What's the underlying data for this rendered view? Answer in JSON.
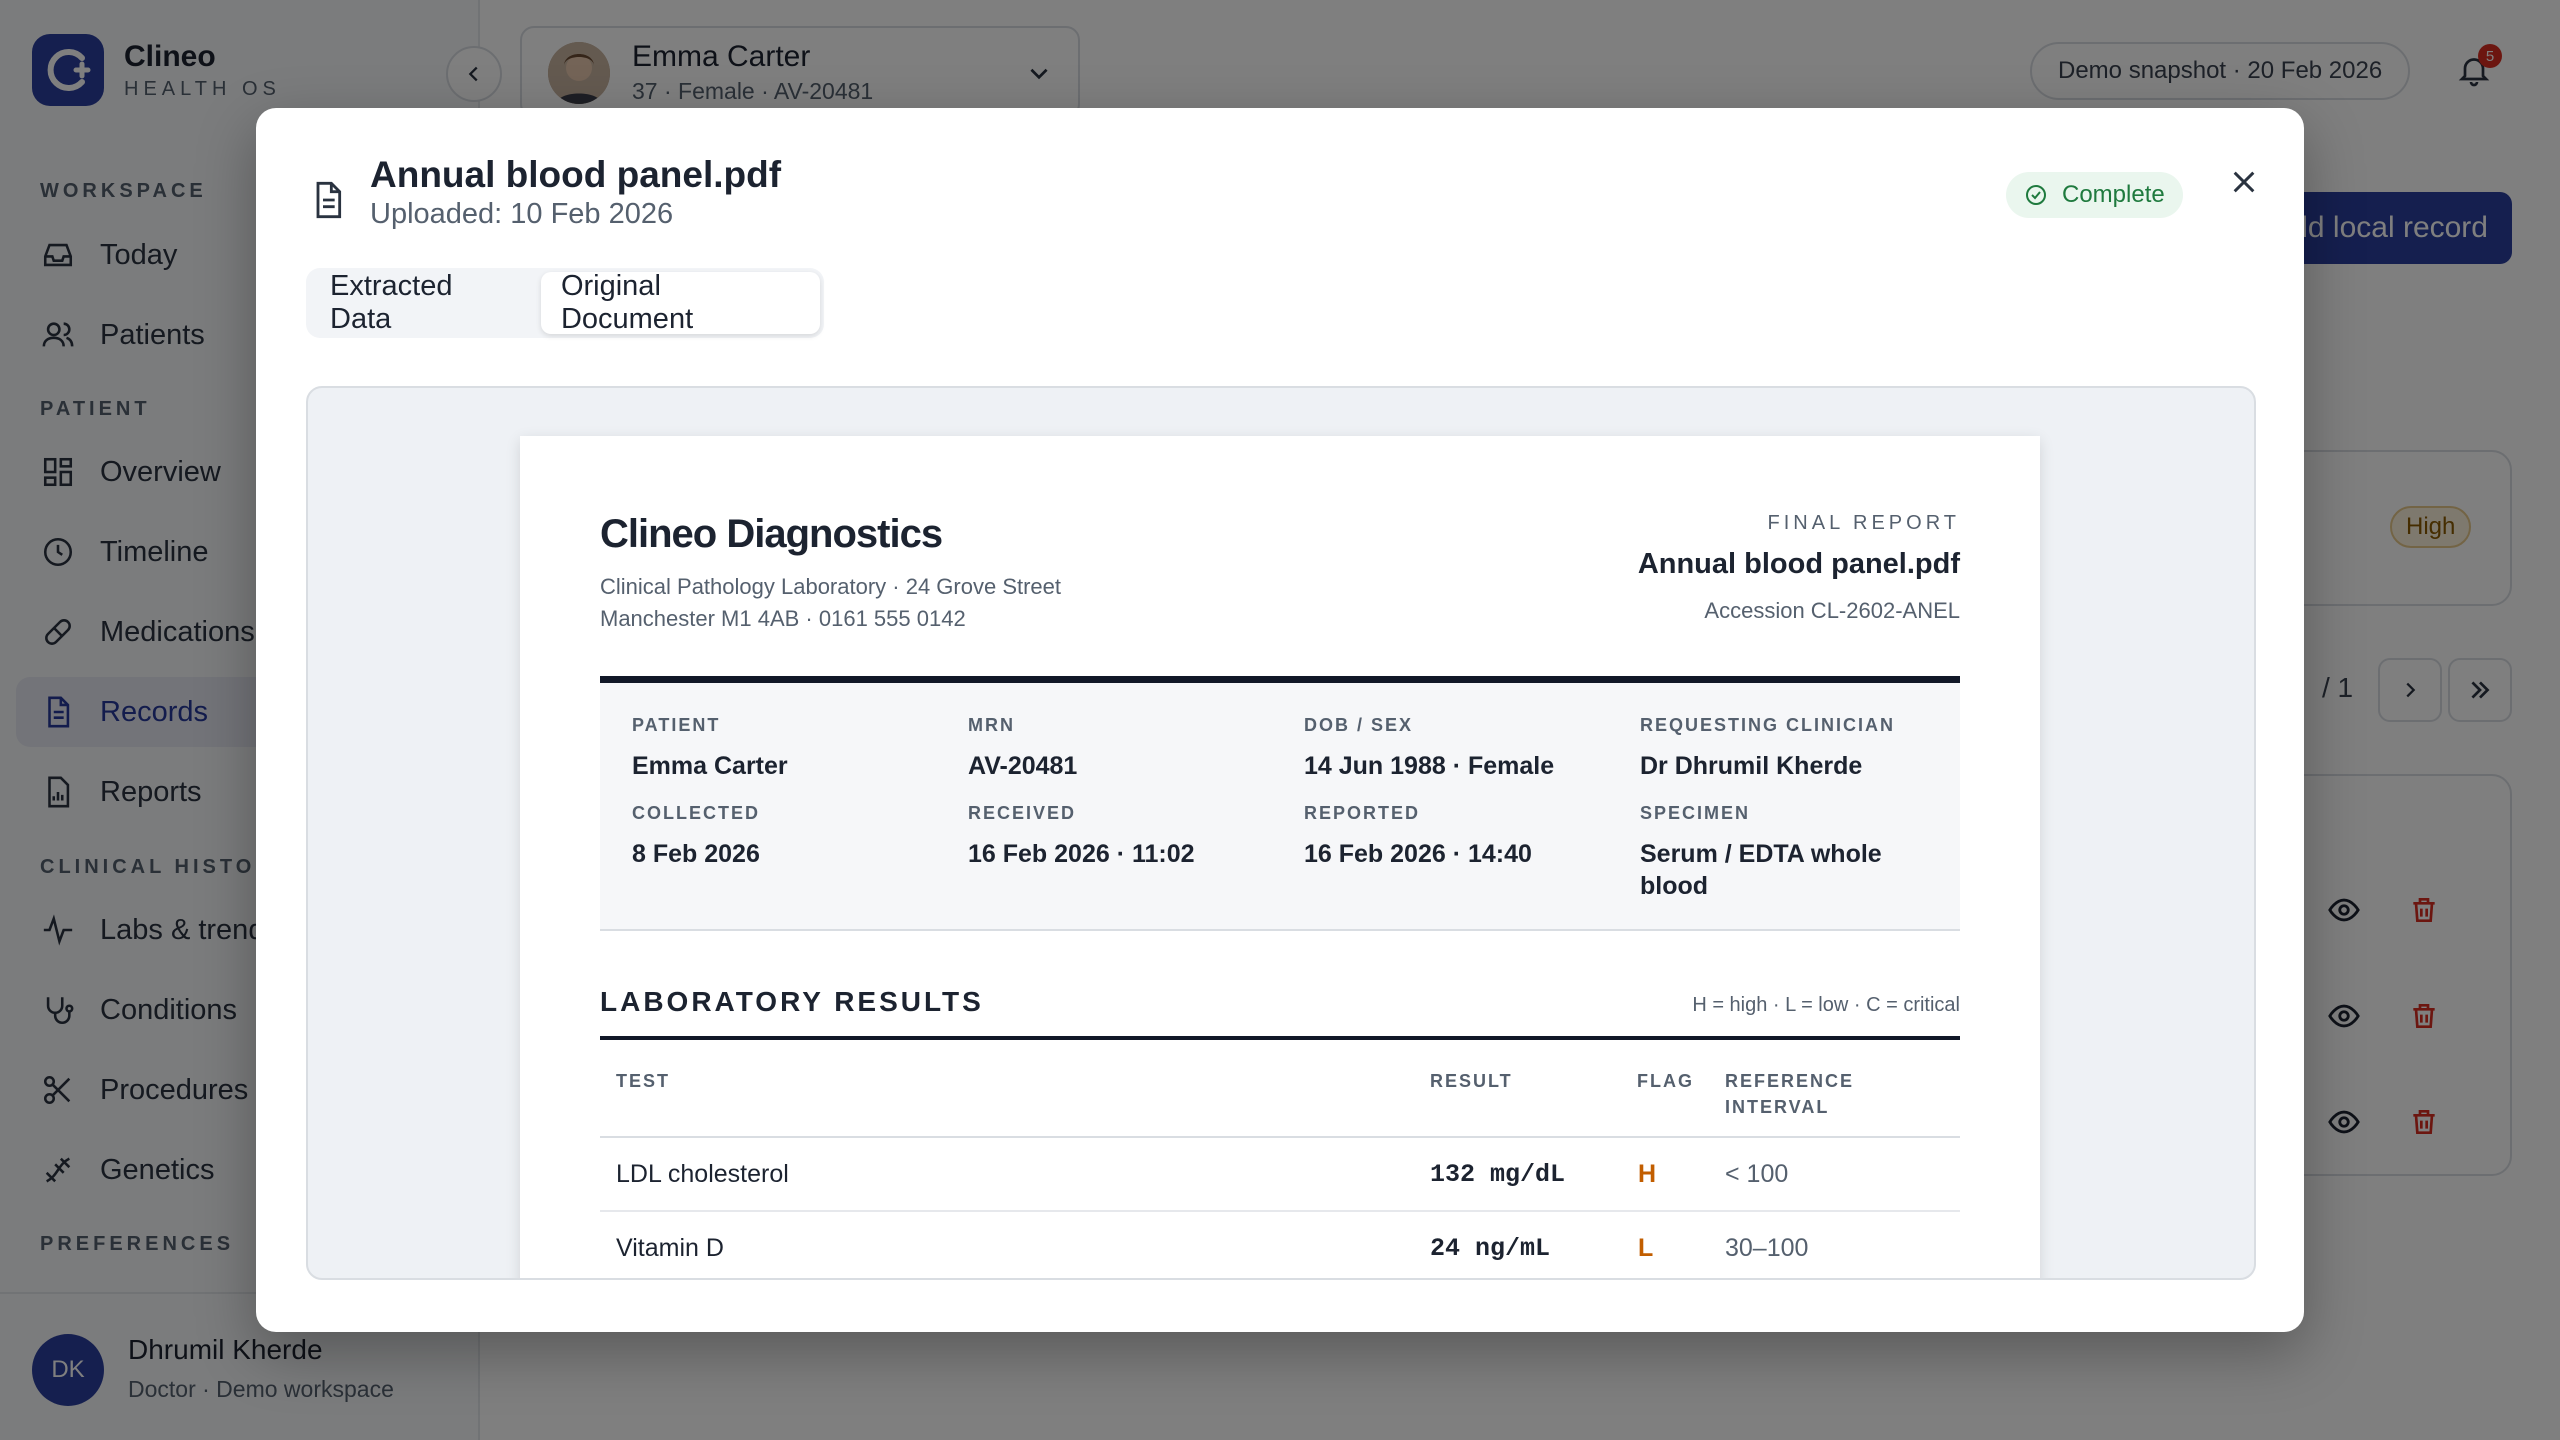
{
  "app": {
    "brand_name": "Clineo",
    "brand_sub": "HEALTH OS",
    "nav_sections": {
      "workspace": "WORKSPACE",
      "patient": "PATIENT",
      "clinical": "CLINICAL HISTORY",
      "preferences": "PREFERENCES"
    },
    "nav": {
      "today": "Today",
      "patients": "Patients",
      "overview": "Overview",
      "timeline": "Timeline",
      "medications": "Medications",
      "records": "Records",
      "reports": "Reports",
      "labs": "Labs & trends",
      "conditions": "Conditions",
      "procedures": "Procedures",
      "genetics": "Genetics"
    },
    "user": {
      "initials": "DK",
      "name": "Dhrumil Kherde",
      "role": "Doctor · Demo workspace"
    },
    "patient": {
      "name": "Emma Carter",
      "meta": "37 · Female · AV-20481"
    },
    "demo_chip": "Demo snapshot · 20 Feb 2026",
    "notification_count": "5",
    "add_button": "Add local record",
    "severity_chip": "High",
    "pager_text": "/ 1"
  },
  "modal": {
    "title": "Annual blood panel.pdf",
    "uploaded": "Uploaded: 10 Feb 2026",
    "status": "Complete",
    "tabs": {
      "extracted": "Extracted Data",
      "original": "Original Document"
    },
    "active_tab": "original"
  },
  "document": {
    "lab_name": "Clineo Diagnostics",
    "address_line1": "Clinical Pathology Laboratory · 24 Grove Street",
    "address_line2": "Manchester M1 4AB · 0161 555 0142",
    "report_label": "FINAL REPORT",
    "report_file": "Annual blood panel.pdf",
    "accession": "Accession CL-2602-ANEL",
    "info": {
      "patient_label": "PATIENT",
      "patient": "Emma Carter",
      "mrn_label": "MRN",
      "mrn": "AV-20481",
      "dob_label": "DOB / SEX",
      "dob": "14 Jun 1988 · Female",
      "clinician_label": "REQUESTING CLINICIAN",
      "clinician": "Dr Dhrumil Kherde",
      "collected_label": "COLLECTED",
      "collected": "8 Feb 2026",
      "received_label": "RECEIVED",
      "received": "16 Feb 2026 · 11:02",
      "reported_label": "REPORTED",
      "reported": "16 Feb 2026 · 14:40",
      "specimen_label": "SPECIMEN",
      "specimen": "Serum / EDTA whole blood"
    },
    "results_title": "LABORATORY RESULTS",
    "legend": "H = high · L = low · C = critical",
    "columns": {
      "test": "TEST",
      "result": "RESULT",
      "flag": "FLAG",
      "ref_line1": "REFERENCE",
      "ref_line2": "INTERVAL"
    },
    "rows": [
      {
        "test": "LDL cholesterol",
        "result": "132 mg/dL",
        "flag": "H",
        "ref": "< 100"
      },
      {
        "test": "Vitamin D",
        "result": "24 ng/mL",
        "flag": "L",
        "ref": "30–100"
      }
    ]
  },
  "colors": {
    "brand": "#2b3f9e",
    "status_green": "#1f7a3e",
    "flag_orange": "#c25e00",
    "danger_red": "#d92d20"
  }
}
